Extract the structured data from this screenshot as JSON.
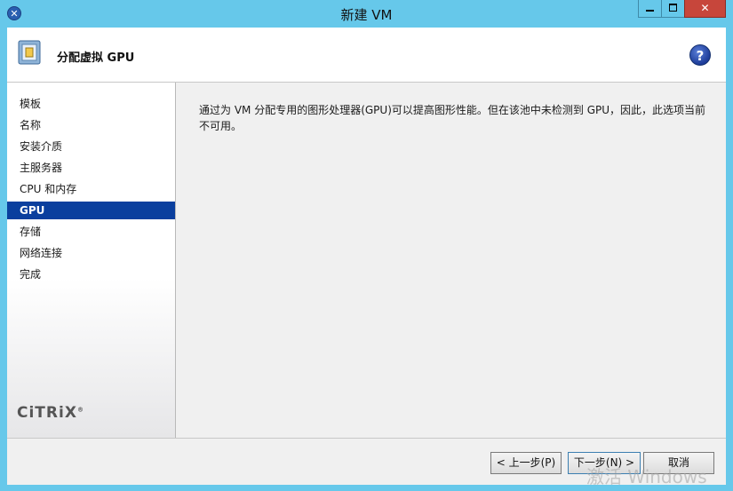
{
  "window": {
    "title": "新建 VM",
    "icon": "xencenter-icon",
    "close_glyph": "✕"
  },
  "header": {
    "title": "分配虚拟 GPU",
    "help_glyph": "?"
  },
  "sidebar": {
    "items": [
      {
        "label": "模板",
        "active": false
      },
      {
        "label": "名称",
        "active": false
      },
      {
        "label": "安装介质",
        "active": false
      },
      {
        "label": "主服务器",
        "active": false
      },
      {
        "label": "CPU 和内存",
        "active": false
      },
      {
        "label": "GPU",
        "active": true
      },
      {
        "label": "存储",
        "active": false
      },
      {
        "label": "网络连接",
        "active": false
      },
      {
        "label": "完成",
        "active": false
      }
    ],
    "logo": "CiTRiX",
    "logo_mark": "®"
  },
  "content": {
    "message": "通过为 VM 分配专用的图形处理器(GPU)可以提高图形性能。但在该池中未检测到 GPU，因此，此选项当前不可用。"
  },
  "footer": {
    "back_label": "< 上一步(P)",
    "next_label": "下一步(N) >",
    "cancel_label": "取消"
  },
  "watermark": "激活 Windows",
  "colors": {
    "titlebar": "#66c8ea",
    "active_nav": "#0a3f9e",
    "close_button": "#c7463b"
  }
}
